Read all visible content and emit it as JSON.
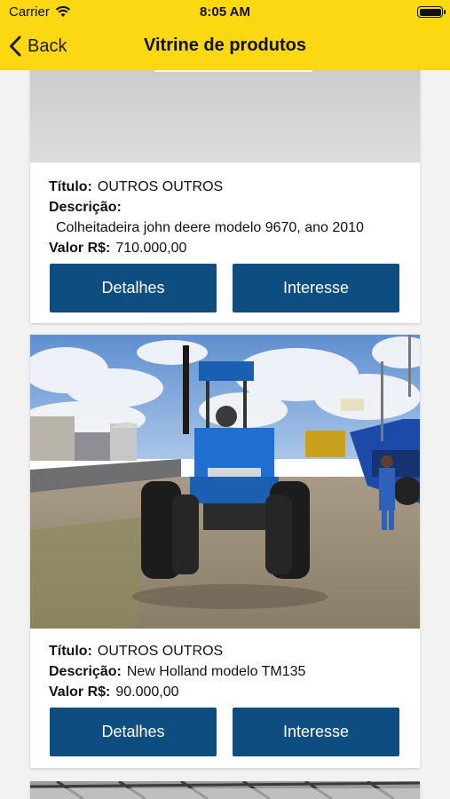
{
  "status_bar": {
    "carrier": "Carrier",
    "time": "8:05 AM"
  },
  "nav": {
    "back_label": "Back",
    "title": "Vitrine de produtos"
  },
  "labels": {
    "titulo": "Título:",
    "descricao": "Descrição:",
    "valor": "Valor R$:"
  },
  "products": [
    {
      "titulo": "OUTROS OUTROS",
      "descricao": "Colheitadeira john deere modelo 9670, ano 2010",
      "valor": "710.000,00",
      "details_label": "Detalhes",
      "interest_label": "Interesse"
    },
    {
      "titulo": "OUTROS OUTROS",
      "descricao": "New Holland modelo TM135",
      "valor": "90.000,00",
      "details_label": "Detalhes",
      "interest_label": "Interesse"
    }
  ],
  "colors": {
    "nav_bg": "#fbd812",
    "button_bg": "#0e4d7f",
    "page_bg": "#f2f2f2"
  }
}
